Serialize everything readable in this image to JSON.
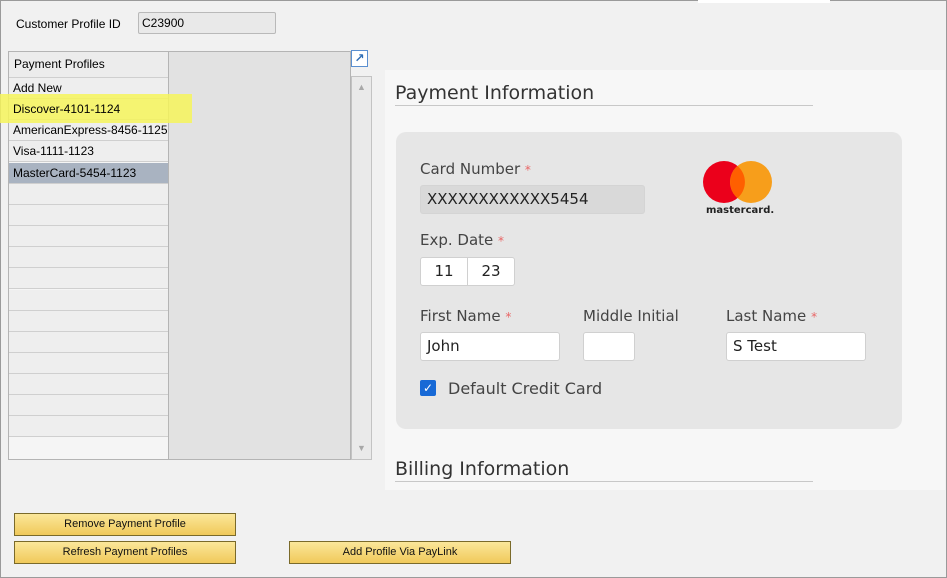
{
  "customer": {
    "label": "Customer Profile ID",
    "value": "C23900"
  },
  "profiles": {
    "header": "Payment Profiles",
    "items": [
      "Add New",
      "Discover-4101-1124",
      "AmericanExpress-8456-1125",
      "Visa-1111-1123",
      "MasterCard-5454-1123"
    ],
    "selected": "MasterCard-5454-1123",
    "highlighted": "Discover-4101-1124"
  },
  "payment": {
    "heading": "Payment Information",
    "card_number_label": "Card Number",
    "card_number": "XXXXXXXXXXXX5454",
    "exp_label": "Exp. Date",
    "exp_month": "11",
    "exp_year": "23",
    "first_name_label": "First Name",
    "first_name": "John",
    "middle_initial_label": "Middle Initial",
    "middle_initial": "",
    "last_name_label": "Last Name",
    "last_name": "S Test",
    "required_mark": "*",
    "default_card_label": "Default Credit Card",
    "default_card_checked": true,
    "card_brand": "mastercard."
  },
  "billing": {
    "heading": "Billing Information"
  },
  "buttons": {
    "remove": "Remove Payment Profile",
    "refresh": "Refresh Payment Profiles",
    "paylink": "Add Profile Via PayLink"
  },
  "colors": {
    "button_gold": "#f0c95a",
    "selected_row": "#a9b3c1",
    "highlight_yellow": "#f6f45a",
    "mastercard_red": "#eb001b",
    "mastercard_orange": "#f79e1b",
    "checkbox_blue": "#1769d6"
  }
}
